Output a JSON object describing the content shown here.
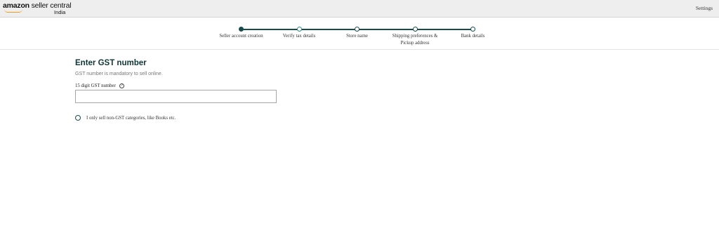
{
  "header": {
    "logo_main_brand": "amazon",
    "logo_main_rest": " seller central",
    "logo_sub": "India",
    "settings_label": "Settings"
  },
  "stepper": {
    "steps": [
      {
        "label": "Seller account creation",
        "state": "completed"
      },
      {
        "label": "Verify tax details",
        "state": "current"
      },
      {
        "label": "Store name",
        "state": "upcoming"
      },
      {
        "label": "Shipping preferences & Pickup address",
        "state": "upcoming"
      },
      {
        "label": "Bank details",
        "state": "upcoming"
      }
    ]
  },
  "form": {
    "title": "Enter GST number",
    "subtitle": "GST number is mandatory to sell online.",
    "gst_label": "15 digit GST number",
    "help_glyph": "?",
    "gst_value": "",
    "gst_placeholder": "",
    "non_gst_option": "I only sell non-GST categories, like Books etc.",
    "non_gst_checked": false
  },
  "colors": {
    "accent": "#1a4b4b",
    "header_bg": "#eeeeee",
    "logo_smile": "#f39a1e"
  }
}
